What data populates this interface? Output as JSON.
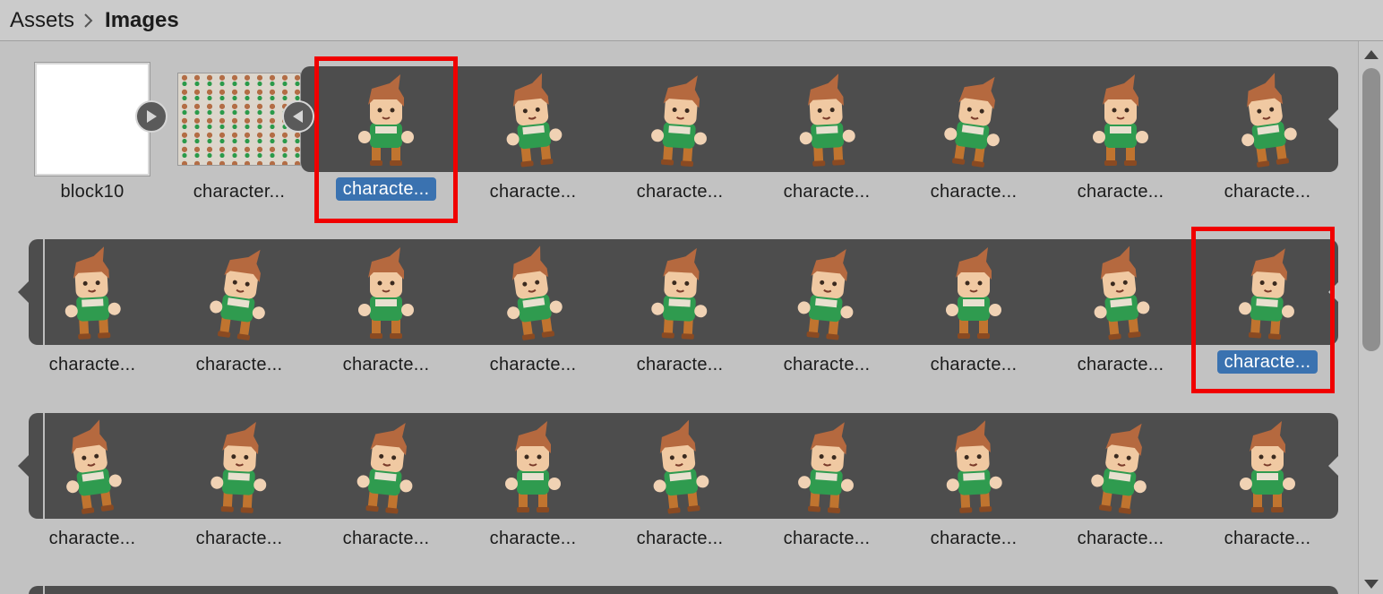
{
  "breadcrumb": {
    "root": "Assets",
    "current": "Images"
  },
  "colors": {
    "selection_highlight": "#3a72b0",
    "annotation_box": "#f00000",
    "strip_bg": "#4d4d4d"
  },
  "assets": [
    {
      "label": "block10",
      "kind": "white-texture"
    },
    {
      "label": "character...",
      "kind": "spritesheet"
    }
  ],
  "sprite_rows": [
    {
      "labels": [
        "characte...",
        "characte...",
        "characte...",
        "characte...",
        "characte...",
        "characte...",
        "characte..."
      ],
      "selected_index": 0
    },
    {
      "labels": [
        "characte...",
        "characte...",
        "characte...",
        "characte...",
        "characte...",
        "characte...",
        "characte...",
        "characte...",
        "characte..."
      ],
      "selected_index": 8
    },
    {
      "labels": [
        "characte...",
        "characte...",
        "characte...",
        "characte...",
        "characte...",
        "characte...",
        "characte...",
        "characte...",
        "characte..."
      ],
      "selected_index": -1
    }
  ],
  "icons": {
    "expand": "play-right-icon",
    "collapse": "play-left-icon",
    "breadcrumb_sep": "chevron-right-icon"
  }
}
